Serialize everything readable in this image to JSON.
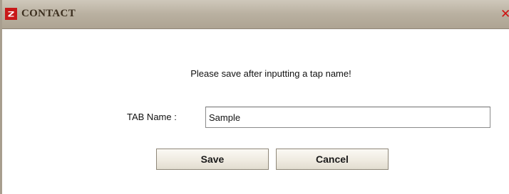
{
  "window": {
    "title": "CONTACT",
    "close_symbol": "✕"
  },
  "icons": {
    "app": "app-logo-icon",
    "close": "close-icon"
  },
  "colors": {
    "titlebar": "#b9b0a0",
    "close": "#d01010",
    "app_icon_border": "#c81818"
  },
  "dialog": {
    "message": "Please save after inputting a tap name!",
    "tab_name_label": "TAB Name :",
    "tab_name_value": "Sample",
    "save_label": "Save",
    "cancel_label": "Cancel"
  }
}
